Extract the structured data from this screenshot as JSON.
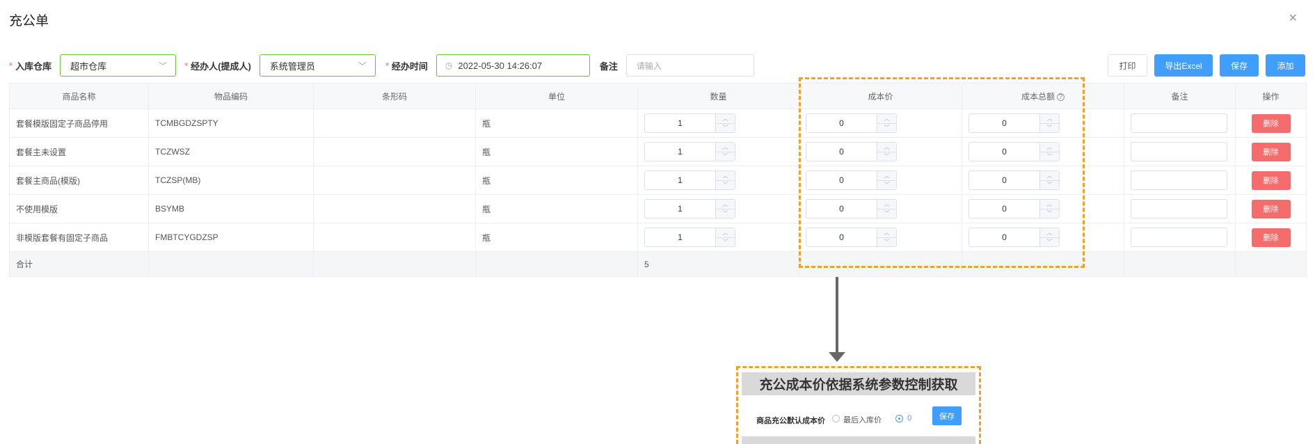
{
  "dialog": {
    "title": "充公单"
  },
  "form": {
    "warehouse": {
      "label": "入库仓库",
      "value": "超市仓库"
    },
    "handler": {
      "label": "经办人(提成人)",
      "value": "系统管理员"
    },
    "time": {
      "label": "经办时间",
      "value": "2022-05-30 14:26:07"
    },
    "remark": {
      "label": "备注",
      "placeholder": "请输入"
    }
  },
  "buttons": {
    "print": "打印",
    "export": "导出Excel",
    "save": "保存",
    "add": "添加"
  },
  "table": {
    "columns": [
      "商品名称",
      "物品编码",
      "条形码",
      "单位",
      "数量",
      "成本价",
      "成本总额",
      "备注",
      "操作"
    ],
    "rows": [
      {
        "name": "套餐模版固定子商品停用",
        "code": "TCMBGDZSPTY",
        "barcode": "",
        "unit": "瓶",
        "qty": "1",
        "cost": "0",
        "total": "0",
        "action": "删除"
      },
      {
        "name": "套餐主未设置",
        "code": "TCZWSZ",
        "barcode": "",
        "unit": "瓶",
        "qty": "1",
        "cost": "0",
        "total": "0",
        "action": "删除"
      },
      {
        "name": "套餐主商品(模版)",
        "code": "TCZSP(MB)",
        "barcode": "",
        "unit": "瓶",
        "qty": "1",
        "cost": "0",
        "total": "0",
        "action": "删除"
      },
      {
        "name": "不使用模版",
        "code": "BSYMB",
        "barcode": "",
        "unit": "瓶",
        "qty": "1",
        "cost": "0",
        "total": "0",
        "action": "删除"
      },
      {
        "name": "非模版套餐有固定子商品",
        "code": "FMBTCYGDZSP",
        "barcode": "",
        "unit": "瓶",
        "qty": "1",
        "cost": "0",
        "total": "0",
        "action": "删除"
      }
    ],
    "summary": {
      "label": "合计",
      "qty": "5"
    }
  },
  "inset": {
    "title": "充公成本价依据系统参数控制获取",
    "param_label": "商品充公默认成本价",
    "option1": "最后入库价",
    "option2": "0",
    "save": "保存"
  },
  "colors": {
    "accent": "#409eff",
    "danger": "#f56c6c",
    "highlight": "#f0a030",
    "focus_border": "#67c23a"
  }
}
